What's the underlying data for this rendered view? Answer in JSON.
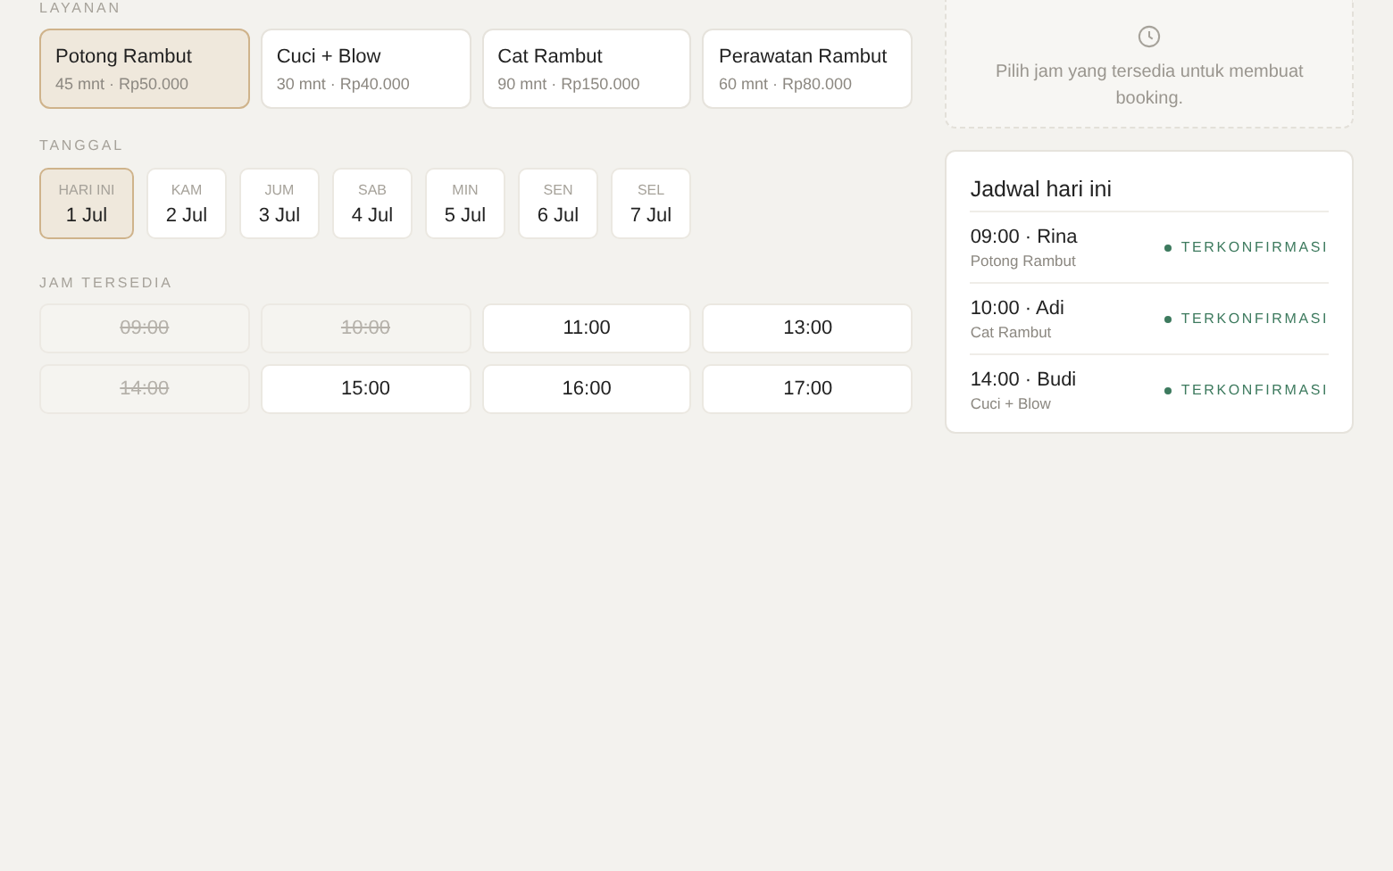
{
  "services_label": "LAYANAN",
  "services": [
    {
      "name": "Potong Rambut",
      "detail": "45 mnt · Rp50.000",
      "selected": true
    },
    {
      "name": "Cuci + Blow",
      "detail": "30 mnt · Rp40.000",
      "selected": false
    },
    {
      "name": "Cat Rambut",
      "detail": "90 mnt · Rp150.000",
      "selected": false
    },
    {
      "name": "Perawatan Rambut",
      "detail": "60 mnt · Rp80.000",
      "selected": false
    }
  ],
  "dates_label": "TANGGAL",
  "dates": [
    {
      "day": "HARI INI",
      "date": "1 Jul",
      "selected": true
    },
    {
      "day": "KAM",
      "date": "2 Jul",
      "selected": false
    },
    {
      "day": "JUM",
      "date": "3 Jul",
      "selected": false
    },
    {
      "day": "SAB",
      "date": "4 Jul",
      "selected": false
    },
    {
      "day": "MIN",
      "date": "5 Jul",
      "selected": false
    },
    {
      "day": "SEN",
      "date": "6 Jul",
      "selected": false
    },
    {
      "day": "SEL",
      "date": "7 Jul",
      "selected": false
    }
  ],
  "slots_label": "JAM TERSEDIA",
  "slots": [
    {
      "time": "09:00",
      "disabled": true
    },
    {
      "time": "10:00",
      "disabled": true
    },
    {
      "time": "11:00",
      "disabled": false
    },
    {
      "time": "13:00",
      "disabled": false
    },
    {
      "time": "14:00",
      "disabled": true
    },
    {
      "time": "15:00",
      "disabled": false
    },
    {
      "time": "16:00",
      "disabled": false
    },
    {
      "time": "17:00",
      "disabled": false
    }
  ],
  "hint": "Pilih jam yang tersedia untuk membuat booking.",
  "schedule": {
    "title": "Jadwal hari ini",
    "items": [
      {
        "title": "09:00 · Rina",
        "service": "Potong Rambut",
        "status": "TERKONFIRMASI",
        "color": "#3d7a5e"
      },
      {
        "title": "10:00 · Adi",
        "service": "Cat Rambut",
        "status": "TERKONFIRMASI",
        "color": "#3d7a5e"
      },
      {
        "title": "14:00 · Budi",
        "service": "Cuci + Blow",
        "status": "TERKONFIRMASI",
        "color": "#3d7a5e"
      }
    ]
  }
}
